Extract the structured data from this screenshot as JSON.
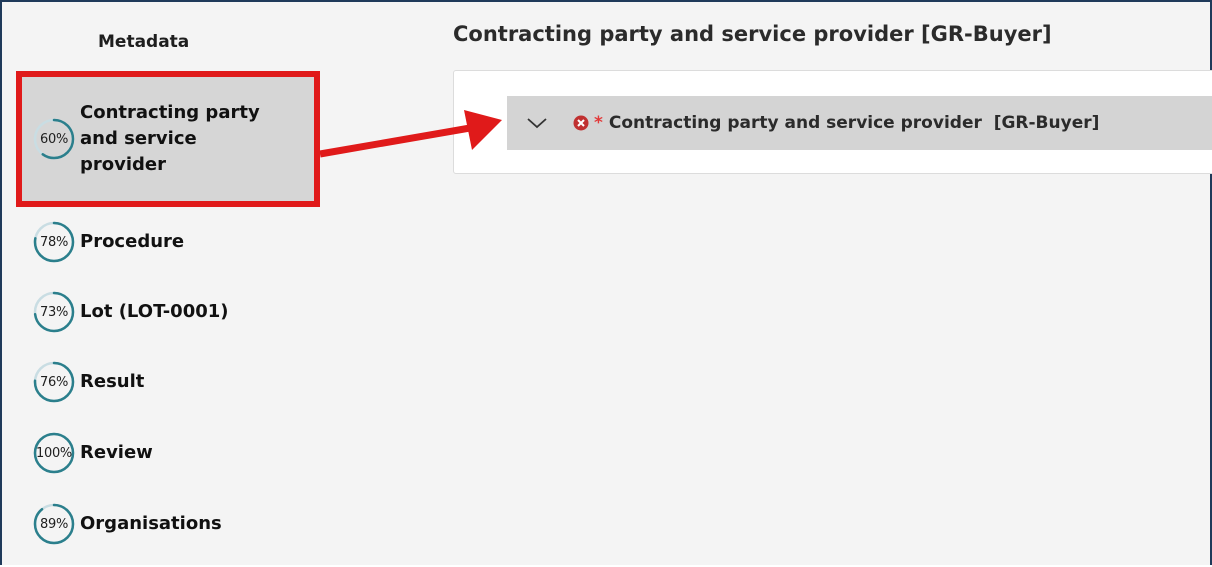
{
  "sidebar": {
    "heading": "Metadata",
    "items": [
      {
        "label_lines": [
          "Contracting party",
          "and service",
          "provider"
        ],
        "percent": "60%",
        "progress": 0.6,
        "active": true
      },
      {
        "label": "Procedure",
        "percent": "78%",
        "progress": 0.78
      },
      {
        "label": "Lot (LOT-0001)",
        "percent": "73%",
        "progress": 0.73
      },
      {
        "label": "Result",
        "percent": "76%",
        "progress": 0.76
      },
      {
        "label": "Review",
        "percent": "100%",
        "progress": 1.0
      },
      {
        "label": "Organisations",
        "percent": "89%",
        "progress": 0.89
      }
    ]
  },
  "main": {
    "title": "Contracting party and service provider [GR-Buyer]",
    "accordion": {
      "required_mark": "*",
      "label": "Contracting party and service provider  [GR-Buyer]",
      "expand_icon": "chevron-down-icon",
      "status_icon": "error-icon"
    }
  },
  "colors": {
    "highlight": "#e01a1a",
    "ring_track": "#c9dde3",
    "ring_progress": "#2b7f8c",
    "error": "#c03030"
  }
}
